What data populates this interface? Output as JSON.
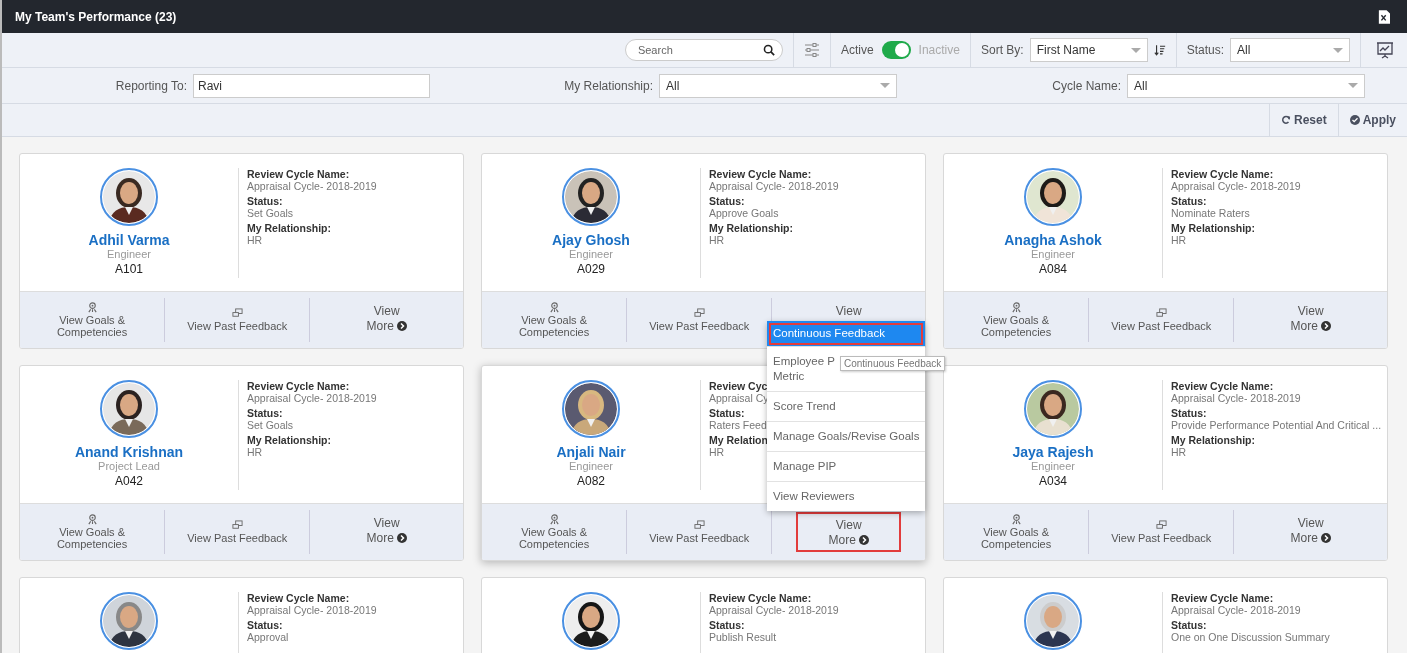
{
  "header": {
    "title": "My Team's Performance (23)"
  },
  "toolbar": {
    "search": {
      "placeholder": "Search"
    },
    "toggle": {
      "on_label": "Active",
      "off_label": "Inactive",
      "on": true
    },
    "sort_by": {
      "label": "Sort By:",
      "value": "First Name"
    },
    "status": {
      "label": "Status:",
      "value": "All"
    }
  },
  "filters": [
    {
      "label": "Reporting To:",
      "value": "Ravi",
      "kind": "text"
    },
    {
      "label": "My Relationship:",
      "value": "All",
      "kind": "select"
    },
    {
      "label": "Cycle Name:",
      "value": "All",
      "kind": "select"
    }
  ],
  "actions": [
    {
      "label": "Reset",
      "kind": "reset"
    },
    {
      "label": "Apply",
      "kind": "apply"
    }
  ],
  "cards": [
    {
      "name": "Adhil Varma",
      "role": "Engineer",
      "code": "A101",
      "fields": [
        {
          "label": "Review Cycle Name:",
          "value": "Appraisal Cycle- 2018-2019"
        },
        {
          "label": "Status:",
          "value": "Set Goals"
        },
        {
          "label": "My Relationship:",
          "value": "HR"
        }
      ],
      "goals": "View Goals & Competencies",
      "feedback": "View Past Feedback",
      "more_line_1": "View",
      "more_line_2": "More",
      "hovered": false,
      "more_highlighted": false
    },
    {
      "name": "Ajay Ghosh",
      "role": "Engineer",
      "code": "A029",
      "fields": [
        {
          "label": "Review Cycle Name:",
          "value": "Appraisal Cycle- 2018-2019"
        },
        {
          "label": "Status:",
          "value": "Approve Goals"
        },
        {
          "label": "My Relationship:",
          "value": "HR"
        }
      ],
      "goals": "View Goals & Competencies",
      "feedback": "View Past Feedback",
      "more_line_1": "View",
      "hovered": false,
      "more_highlighted": false
    },
    {
      "name": "Anagha Ashok",
      "role": "Engineer",
      "code": "A084",
      "fields": [
        {
          "label": "Review Cycle Name:",
          "value": "Appraisal Cycle- 2018-2019"
        },
        {
          "label": "Status:",
          "value": "Nominate Raters"
        },
        {
          "label": "My Relationship:",
          "value": "HR"
        }
      ],
      "goals": "View Goals & Competencies",
      "feedback": "View Past Feedback",
      "more_line_1": "View",
      "more_line_2": "More",
      "hovered": false,
      "more_highlighted": false
    },
    {
      "name": "Anand Krishnan",
      "role": "Project Lead",
      "code": "A042",
      "fields": [
        {
          "label": "Review Cycle Name:",
          "value": "Appraisal Cycle- 2018-2019"
        },
        {
          "label": "Status:",
          "value": "Set Goals"
        },
        {
          "label": "My Relationship:",
          "value": "HR"
        }
      ],
      "goals": "View Goals & Competencies",
      "feedback": "View Past Feedback",
      "more_line_1": "View",
      "more_line_2": "More",
      "hovered": false,
      "more_highlighted": false
    },
    {
      "name": "Anjali Nair",
      "role": "Engineer",
      "code": "A082",
      "fields": [
        {
          "label": "Review Cyc",
          "value": "Appraisal Cy"
        },
        {
          "label": "Status:",
          "value": "Raters Feed"
        },
        {
          "label": "My Relation",
          "value": "HR"
        }
      ],
      "goals": "View Goals & Competencies",
      "feedback": "View Past Feedback",
      "more_line_1": "View",
      "more_line_2": "More",
      "hovered": true,
      "more_highlighted": true
    },
    {
      "name": "Jaya Rajesh",
      "role": "Engineer",
      "code": "A034",
      "fields": [
        {
          "label": "Review Cycle Name:",
          "value": "Appraisal Cycle- 2018-2019"
        },
        {
          "label": "Status:",
          "value": "Provide Performance Potential And Critical ..."
        },
        {
          "label": "My Relationship:",
          "value": "HR"
        }
      ],
      "goals": "View Goals & Competencies",
      "feedback": "View Past Feedback",
      "more_line_1": "View",
      "more_line_2": "More",
      "hovered": false,
      "more_highlighted": false
    },
    {
      "fields": [
        {
          "label": "Review Cycle Name:",
          "value": "Appraisal Cycle- 2018-2019"
        },
        {
          "label": "Status:",
          "value": "Approval"
        }
      ],
      "hovered": false
    },
    {
      "fields": [
        {
          "label": "Review Cycle Name:",
          "value": "Appraisal Cycle- 2018-2019"
        },
        {
          "label": "Status:",
          "value": "Publish Result"
        }
      ],
      "hovered": false
    },
    {
      "fields": [
        {
          "label": "Review Cycle Name:",
          "value": "Appraisal Cycle- 2018-2019"
        },
        {
          "label": "Status:",
          "value": "One on One Discussion Summary"
        }
      ],
      "hovered": false
    }
  ],
  "menu": {
    "items": [
      {
        "label": "Continuous Feedback",
        "selected": true,
        "highlighted": true
      },
      {
        "label": "Employee P\nMetric",
        "selected": false,
        "highlighted": false
      },
      {
        "label": "Score Trend",
        "selected": false,
        "highlighted": false
      },
      {
        "label": "Manage Goals/Revise Goals",
        "selected": false,
        "highlighted": false
      },
      {
        "label": "Manage PIP",
        "selected": false,
        "highlighted": false
      },
      {
        "label": "View Reviewers",
        "selected": false,
        "highlighted": false
      }
    ]
  },
  "tooltip": {
    "text": "Continuous Feedback"
  }
}
